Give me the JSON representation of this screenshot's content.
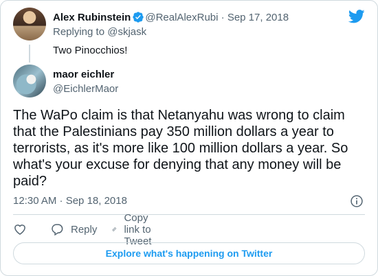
{
  "colors": {
    "accent": "#1d9bf0",
    "muted": "#536471",
    "text": "#0f1419",
    "border": "#cfd9de"
  },
  "parent_tweet": {
    "author_name": "Alex Rubinstein",
    "handle": "@RealAlexRubi",
    "separator": "·",
    "date": "Sep 17, 2018",
    "replying_to": "Replying to @skjask",
    "text": "Two Pinocchios!"
  },
  "main_tweet": {
    "author_name": "maor eichler",
    "handle": "@EichlerMaor",
    "text": "The WaPo claim is that Netanyahu was wrong to claim that the Palestinians pay 350 million dollars a year to terrorists, as it's more like 100 million dollars a year. So what's your excuse for denying that any money will be paid?",
    "timestamp": "12:30 AM · Sep 18, 2018"
  },
  "actions": {
    "reply_label": "Reply",
    "copy_label": "Copy link to Tweet"
  },
  "explore_label": "Explore what's happening on Twitter",
  "icons": [
    "twitter-logo-icon",
    "verified-badge-icon",
    "info-icon",
    "heart-icon",
    "reply-icon",
    "link-icon"
  ]
}
